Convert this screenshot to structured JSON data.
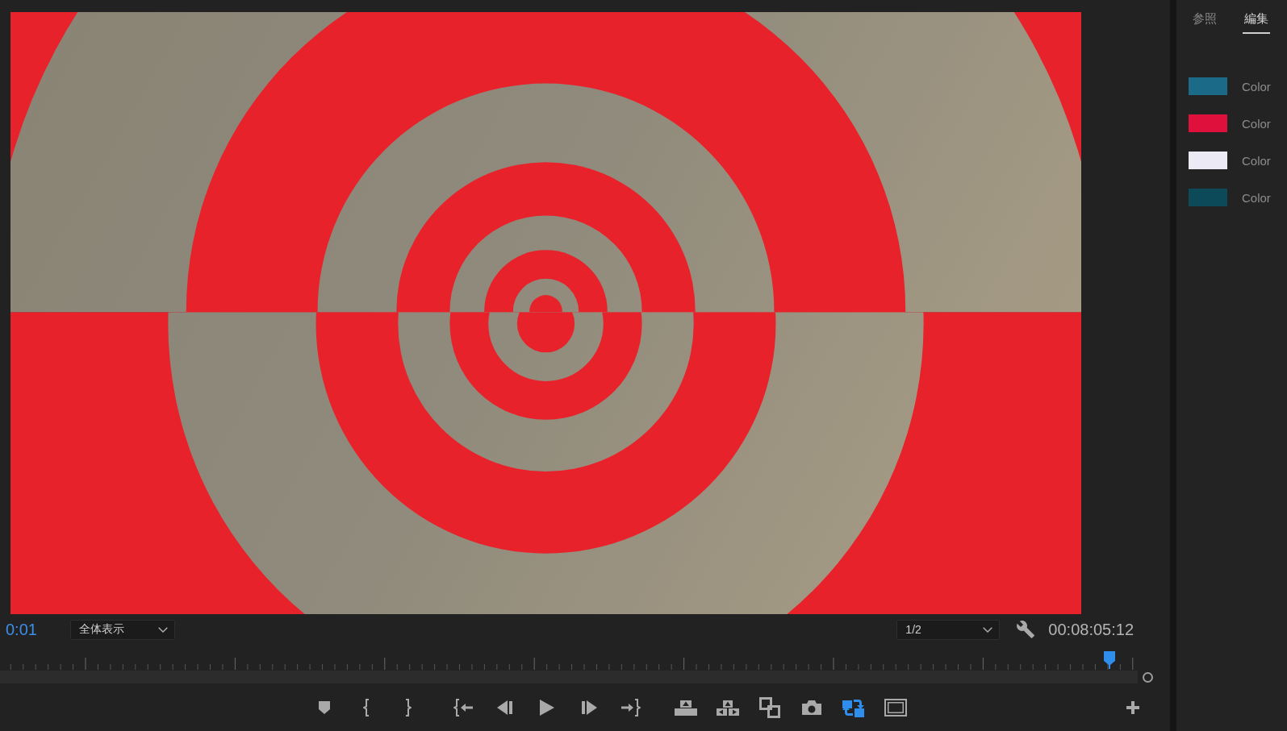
{
  "monitor": {
    "timecode_current": "0:01",
    "zoom_dropdown": {
      "value": "全体表示"
    },
    "resolution_dropdown": {
      "value": "1/2"
    },
    "timecode_duration": "00:08:05:12",
    "playhead": {
      "level": 0.975
    },
    "button_groups": [
      [
        {
          "kind": "marker",
          "on": false
        },
        {
          "kind": "mark_in",
          "on": false
        },
        {
          "kind": "mark_out",
          "on": false
        }
      ],
      [
        {
          "kind": "go_to_in",
          "on": false
        },
        {
          "kind": "step_back",
          "on": false
        },
        {
          "kind": "play",
          "on": false
        },
        {
          "kind": "step_forward",
          "on": false
        },
        {
          "kind": "go_to_out",
          "on": false
        }
      ],
      [
        {
          "kind": "lift",
          "on": false
        },
        {
          "kind": "extract",
          "on": false
        },
        {
          "kind": "compare",
          "on": false
        },
        {
          "kind": "export_frame",
          "on": false
        },
        {
          "kind": "proxy",
          "on": true
        },
        {
          "kind": "safe_margins",
          "on": false
        }
      ]
    ]
  },
  "side_panel": {
    "tabs": [
      {
        "label": "参照",
        "selected": false
      },
      {
        "label": "編集",
        "selected": true
      }
    ],
    "swatches": [
      {
        "color": "#1a6a88",
        "label": "Color"
      },
      {
        "color": "#e0103c",
        "label": "Color"
      },
      {
        "color": "#ecebf5",
        "label": "Color"
      },
      {
        "color": "#0c4a5a",
        "label": "Color"
      }
    ]
  }
}
